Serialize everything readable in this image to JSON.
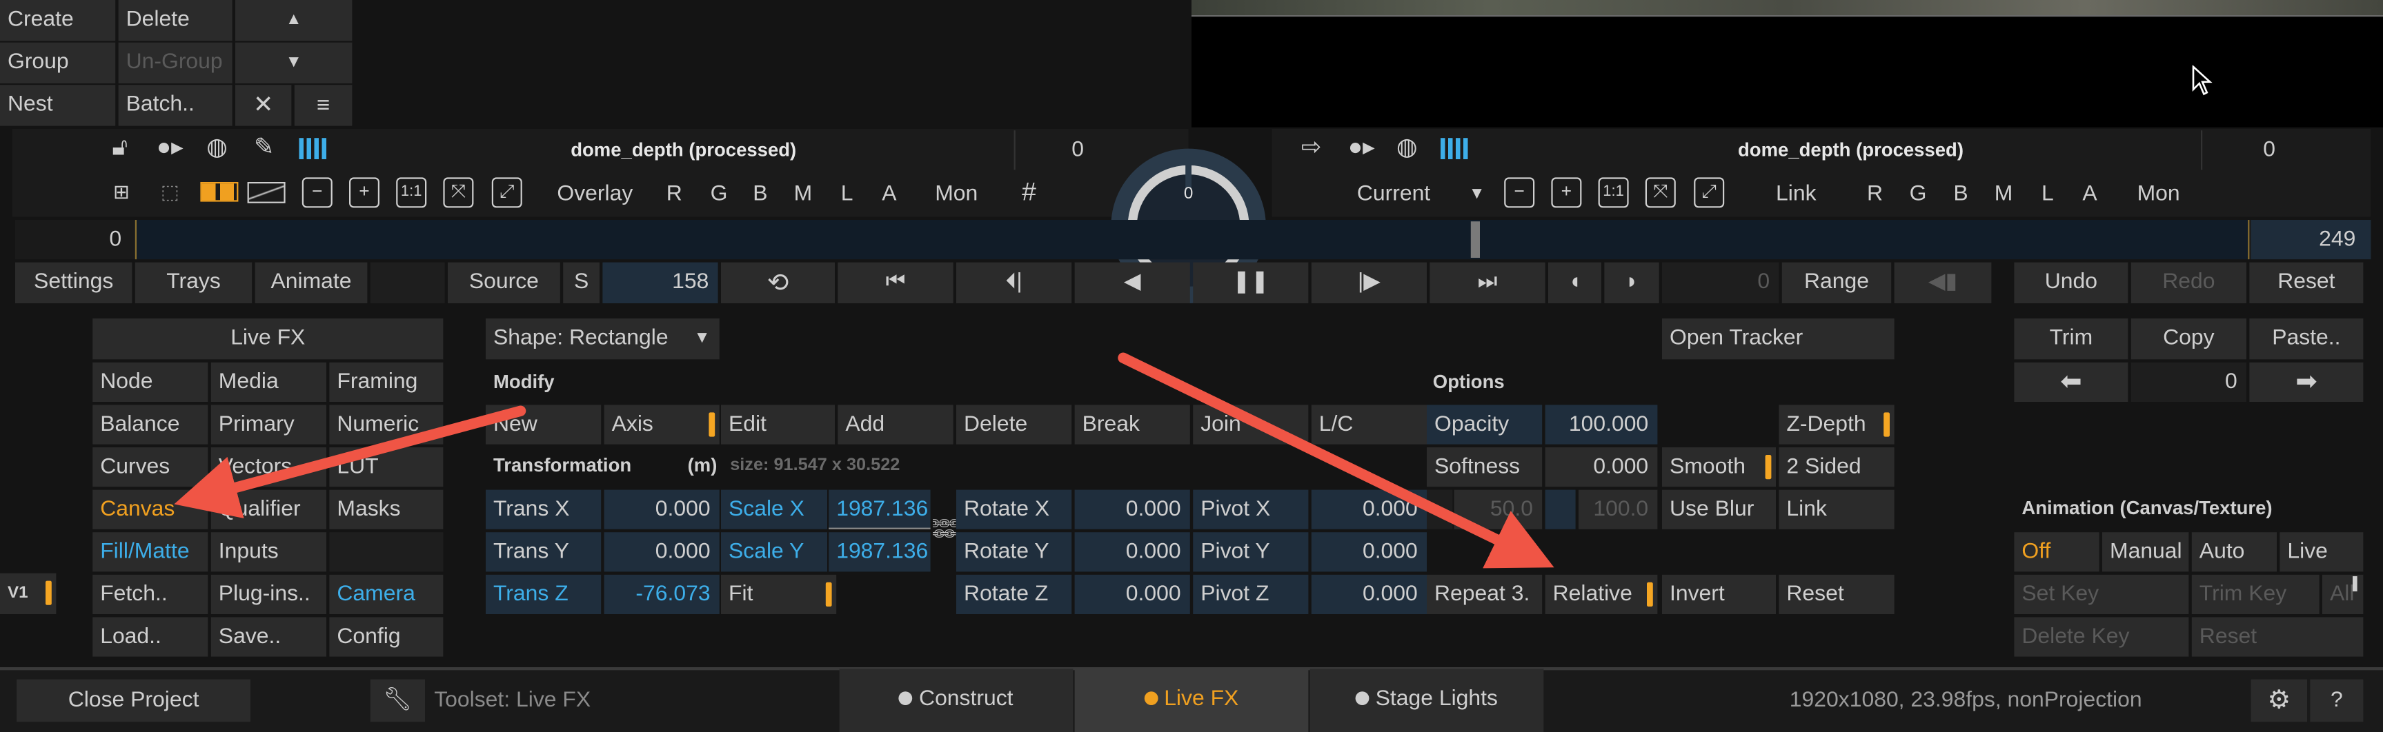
{
  "top_menu": {
    "create": "Create",
    "delete": "Delete",
    "group": "Group",
    "ungroup": "Un-Group",
    "nest": "Nest",
    "batch": "Batch.."
  },
  "viewer_left": {
    "title": "dome_depth (processed)",
    "frame": "0",
    "overlay_label": "Overlay",
    "channels": [
      "R",
      "G",
      "B",
      "M",
      "L",
      "A"
    ],
    "mon": "Mon"
  },
  "viewer_right": {
    "title": "dome_depth (processed)",
    "frame": "0",
    "current": "Current",
    "link": "Link",
    "channels": [
      "R",
      "G",
      "B",
      "M",
      "L",
      "A"
    ],
    "mon": "Mon"
  },
  "dial": {
    "value": "0"
  },
  "timeline": {
    "start": "0",
    "end": "249",
    "playhead_fraction": 0.5
  },
  "transport": {
    "settings": "Settings",
    "trays": "Trays",
    "animate": "Animate",
    "source": "Source",
    "s": "S",
    "frame": "158",
    "frame2": "0",
    "range": "Range",
    "undo": "Undo",
    "redo": "Redo",
    "reset": "Reset"
  },
  "livefx_menu": {
    "header": "Live FX",
    "rows": [
      [
        "Node",
        "Media",
        "Framing"
      ],
      [
        "Balance",
        "Primary",
        "Numeric"
      ],
      [
        "Curves",
        "Vectors",
        "LUT"
      ],
      [
        "Canvas",
        "Qualifier",
        "Masks"
      ],
      [
        "Fill/Matte",
        "Inputs",
        ""
      ],
      [
        "Fetch..",
        "Plug-ins..",
        "Camera"
      ],
      [
        "Load..",
        "Save..",
        "Config"
      ]
    ]
  },
  "version": "V1",
  "shape": {
    "dropdown": "Shape: Rectangle",
    "modify_title": "Modify",
    "modify_buttons": [
      "New",
      "Axis",
      "Edit",
      "Add",
      "Delete",
      "Break",
      "Join",
      "L/C"
    ],
    "transformation_title": "Transformation",
    "unit": "(m)",
    "size": "size: 91.547 x 30.522",
    "trans_x_label": "Trans X",
    "trans_x": "0.000",
    "trans_y_label": "Trans Y",
    "trans_y": "0.000",
    "trans_z_label": "Trans Z",
    "trans_z": "-76.073",
    "scale_x_label": "Scale X",
    "scale_x": "1987.136",
    "scale_y_label": "Scale Y",
    "scale_y": "1987.136",
    "fit": "Fit",
    "rotate_x_label": "Rotate X",
    "rotate_x": "0.000",
    "rotate_y_label": "Rotate Y",
    "rotate_y": "0.000",
    "rotate_z_label": "Rotate Z",
    "rotate_z": "0.000",
    "pivot_x_label": "Pivot X",
    "pivot_x": "0.000",
    "pivot_y_label": "Pivot Y",
    "pivot_y": "0.000",
    "pivot_z_label": "Pivot Z",
    "pivot_z": "0.000"
  },
  "options": {
    "title": "Options",
    "opacity_label": "Opacity",
    "opacity": "100.000",
    "softness_label": "Softness",
    "softness": "0.000",
    "val_a": "50.0",
    "val_b": "100.0",
    "repeat": "Repeat 3.",
    "relative": "Relative",
    "open_tracker": "Open Tracker",
    "smooth": "Smooth",
    "use_blur": "Use Blur",
    "invert": "Invert",
    "z_depth": "Z-Depth",
    "two_sided": "2 Sided",
    "link": "Link",
    "reset": "Reset"
  },
  "edit_panel": {
    "trim": "Trim",
    "copy": "Copy",
    "paste": "Paste..",
    "value": "0"
  },
  "animation": {
    "title": "Animation (Canvas/Texture)",
    "off": "Off",
    "manual": "Manual",
    "auto": "Auto",
    "live": "Live",
    "set_key": "Set Key",
    "trim_key": "Trim Key",
    "all": "All",
    "delete_key": "Delete Key",
    "reset": "Reset"
  },
  "bottom": {
    "close_project": "Close Project",
    "toolset": "Toolset: Live FX",
    "tabs": [
      "Construct",
      "Live FX",
      "Stage Lights"
    ],
    "status": "1920x1080, 23.98fps, nonProjection"
  },
  "colors": {
    "accent_orange": "#f0a020",
    "accent_blue": "#3daee9",
    "annotation_arrow": "#f05545"
  }
}
